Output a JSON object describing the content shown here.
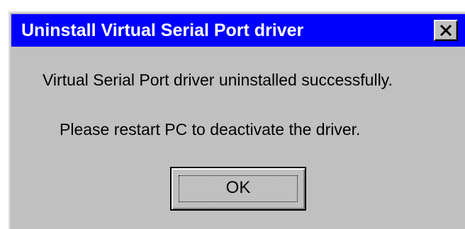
{
  "window": {
    "title": "Uninstall Virtual Serial Port driver",
    "close_icon": "close-icon"
  },
  "message": {
    "line1": "Virtual Serial Port driver uninstalled successfully.",
    "line2": "Please restart PC to deactivate the driver."
  },
  "buttons": {
    "ok_label": "OK"
  },
  "colors": {
    "titlebar": "#0000ff",
    "face": "#c0c0c0",
    "title_text": "#ffffff"
  }
}
